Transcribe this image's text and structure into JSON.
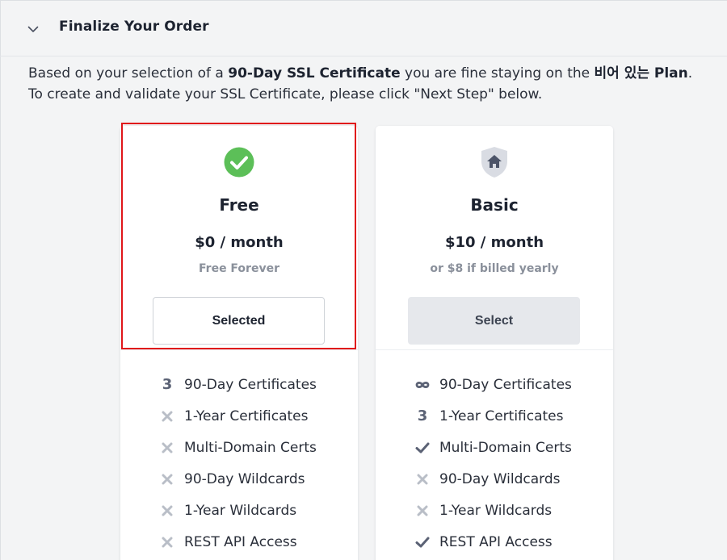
{
  "header": {
    "title": "Finalize Your Order",
    "chevron_icon": "chevron-down-icon"
  },
  "intro": {
    "part1": "Based on your selection of a ",
    "certificate": "90-Day SSL Certificate",
    "part2": " you are fine staying on the ",
    "plan": "비어 있는 Plan",
    "part3": ". To create and validate your SSL Certificate, please click \"Next Step\" below."
  },
  "plans": [
    {
      "icon": "check-circle-icon",
      "name": "Free",
      "price": "$0 / month",
      "subtext": "Free Forever",
      "button_label": "Selected",
      "selected": true,
      "features": [
        {
          "icon": "count",
          "mark": "3",
          "label": "90-Day Certificates"
        },
        {
          "icon": "x-icon",
          "label": "1-Year Certificates"
        },
        {
          "icon": "x-icon",
          "label": "Multi-Domain Certs"
        },
        {
          "icon": "x-icon",
          "label": "90-Day Wildcards"
        },
        {
          "icon": "x-icon",
          "label": "1-Year Wildcards"
        },
        {
          "icon": "x-icon",
          "label": "REST API Access"
        }
      ]
    },
    {
      "icon": "shield-home-icon",
      "name": "Basic",
      "price": "$10 / month",
      "subtext": "or $8 if billed yearly",
      "button_label": "Select",
      "selected": false,
      "features": [
        {
          "icon": "infinity-icon",
          "label": "90-Day Certificates"
        },
        {
          "icon": "count",
          "mark": "3",
          "label": "1-Year Certificates"
        },
        {
          "icon": "check-icon",
          "label": "Multi-Domain Certs"
        },
        {
          "icon": "x-icon",
          "label": "90-Day Wildcards"
        },
        {
          "icon": "x-icon",
          "label": "1-Year Wildcards"
        },
        {
          "icon": "check-icon",
          "label": "REST API Access"
        }
      ]
    }
  ],
  "colors": {
    "accent_green": "#5cbf58",
    "highlight_red": "#e0161a",
    "icon_slate": "#5b6275",
    "x_gray": "#b9bec7"
  }
}
